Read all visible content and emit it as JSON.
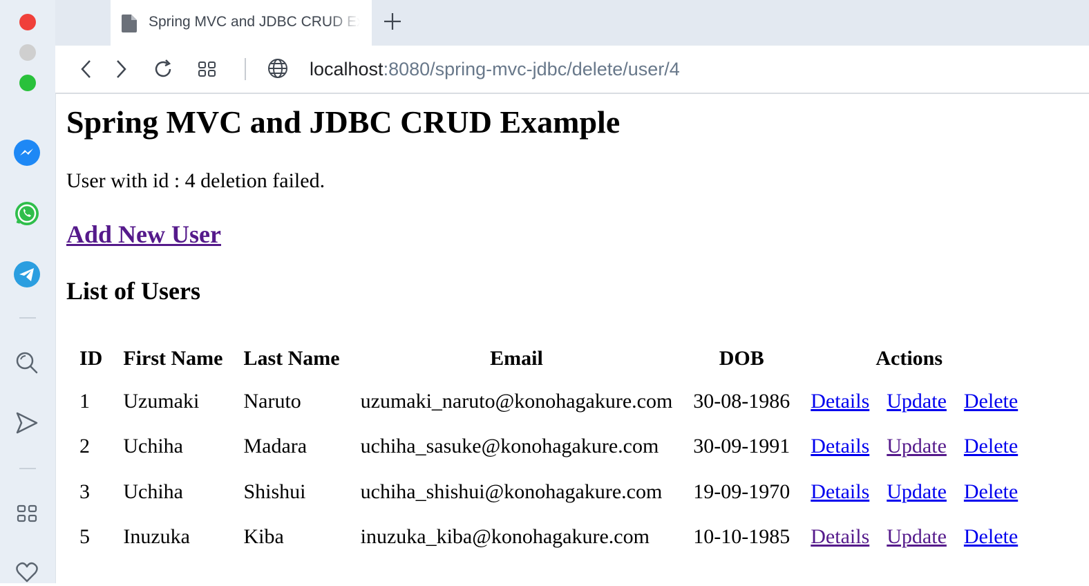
{
  "browser": {
    "tab_title": "Spring MVC and JDBC CRUD Example",
    "url_host": "localhost",
    "url_path": ":8080/spring-mvc-jdbc/delete/user/4",
    "colors": {
      "sidebar_bg": "#e8eef5",
      "url_path": "#68788a",
      "close": "#f0403a",
      "zoom": "#29c13b"
    },
    "sidebar_icons": [
      "messenger-icon",
      "whatsapp-icon",
      "telegram-icon",
      "search-icon",
      "send-icon",
      "apps-grid-icon",
      "heart-icon"
    ]
  },
  "page": {
    "title": "Spring MVC and JDBC CRUD Example",
    "status_message": "User with id : 4 deletion failed.",
    "add_link": "Add New User",
    "list_title": "List of Users",
    "table": {
      "headers": [
        "ID",
        "First Name",
        "Last Name",
        "Email",
        "DOB",
        "Actions"
      ],
      "rows": [
        {
          "id": "1",
          "first": "Uzumaki",
          "last": "Naruto",
          "email": "uzumaki_naruto@konohagakure.com",
          "dob": "30-08-1986",
          "details": "Details",
          "update": "Update",
          "delete": "Delete"
        },
        {
          "id": "2",
          "first": "Uchiha",
          "last": "Madara",
          "email": "uchiha_sasuke@konohagakure.com",
          "dob": "30-09-1991",
          "details": "Details",
          "update": "Update",
          "delete": "Delete"
        },
        {
          "id": "3",
          "first": "Uchiha",
          "last": "Shishui",
          "email": "uchiha_shishui@konohagakure.com",
          "dob": "19-09-1970",
          "details": "Details",
          "update": "Update",
          "delete": "Delete"
        },
        {
          "id": "5",
          "first": "Inuzuka",
          "last": "Kiba",
          "email": "inuzuka_kiba@konohagakure.com",
          "dob": "10-10-1985",
          "details": "Details",
          "update": "Update",
          "delete": "Delete"
        }
      ]
    },
    "link_colors": {
      "unvisited": "#0000ee",
      "visited": "#551a8b"
    }
  }
}
